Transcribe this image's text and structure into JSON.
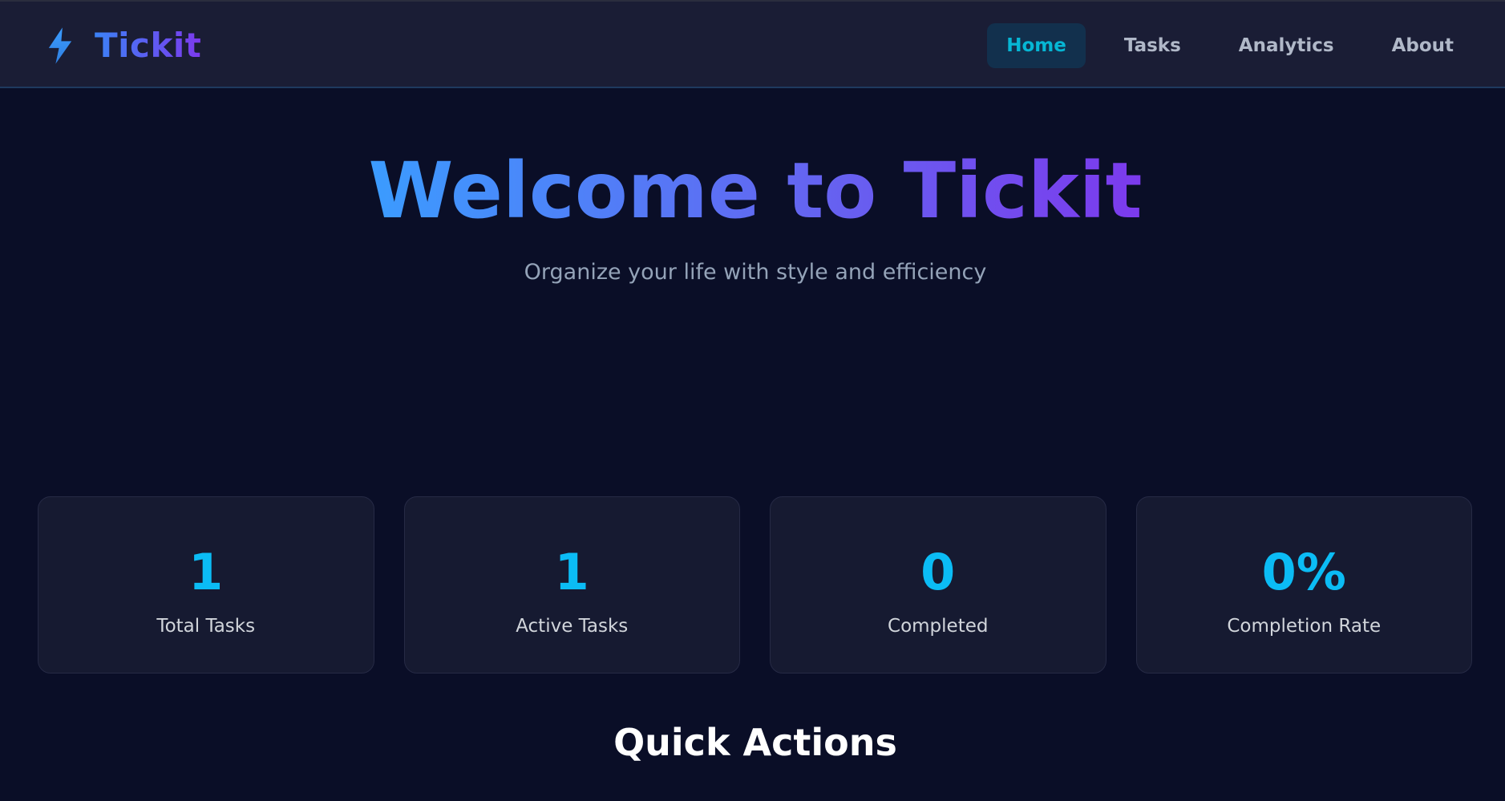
{
  "brand": {
    "icon": "lightning-bolt-icon",
    "name": "Tickit"
  },
  "nav": {
    "items": [
      {
        "label": "Home",
        "active": true
      },
      {
        "label": "Tasks",
        "active": false
      },
      {
        "label": "Analytics",
        "active": false
      },
      {
        "label": "About",
        "active": false
      }
    ]
  },
  "hero": {
    "title": "Welcome to Tickit",
    "subtitle": "Organize your life with style and efficiency"
  },
  "stats": [
    {
      "value": "1",
      "label": "Total Tasks"
    },
    {
      "value": "1",
      "label": "Active Tasks"
    },
    {
      "value": "0",
      "label": "Completed"
    },
    {
      "value": "0%",
      "label": "Completion Rate"
    }
  ],
  "quick_actions": {
    "title": "Quick Actions"
  },
  "colors": {
    "background": "#0a0e27",
    "navbar": "#1a1d35",
    "accent": "#06b6d4",
    "gradient_start": "#3b82f6",
    "gradient_end": "#7c3aed",
    "card": "#161a31"
  }
}
